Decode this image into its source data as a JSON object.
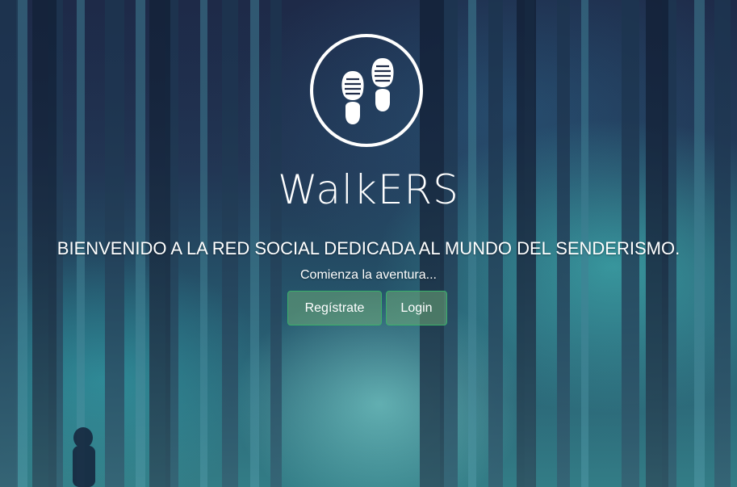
{
  "brand": {
    "logo_icon": "footprints-icon",
    "name": "WalkERS"
  },
  "hero": {
    "headline": "BIENVENIDO A LA RED SOCIAL DEDICADA AL MUNDO DEL SENDERISMO.",
    "subline": "Comienza la aventura..."
  },
  "actions": {
    "register_label": "Regístrate",
    "login_label": "Login"
  },
  "colors": {
    "button_border": "#39b06a",
    "text": "#ffffff"
  }
}
